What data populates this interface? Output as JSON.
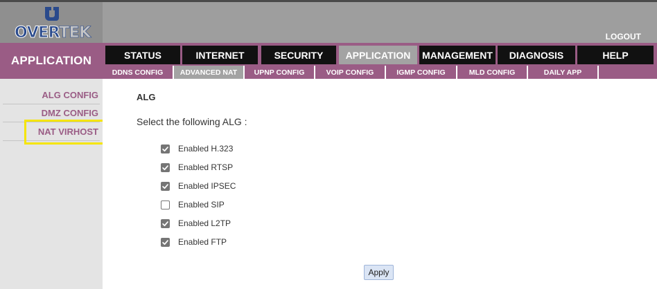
{
  "brand": {
    "logo_text": "OVERTEK"
  },
  "header": {
    "logout_label": "LOGOUT"
  },
  "section_title": "APPLICATION",
  "main_nav": [
    {
      "label": "STATUS",
      "active": false
    },
    {
      "label": "INTERNET",
      "active": false
    },
    {
      "label": "SECURITY",
      "active": false
    },
    {
      "label": "APPLICATION",
      "active": true
    },
    {
      "label": "MANAGEMENT",
      "active": false
    },
    {
      "label": "DIAGNOSIS",
      "active": false
    },
    {
      "label": "HELP",
      "active": false
    }
  ],
  "sub_nav": [
    {
      "label": "DDNS CONFIG",
      "active": false
    },
    {
      "label": "ADVANCED NAT",
      "active": true
    },
    {
      "label": "UPNP CONFIG",
      "active": false
    },
    {
      "label": "VOIP CONFIG",
      "active": false
    },
    {
      "label": "IGMP CONFIG",
      "active": false
    },
    {
      "label": "MLD CONFIG",
      "active": false
    },
    {
      "label": "DAILY APP",
      "active": false
    }
  ],
  "sidebar": [
    {
      "label": "ALG CONFIG",
      "highlighted": false
    },
    {
      "label": "DMZ CONFIG",
      "highlighted": false
    },
    {
      "label": "NAT VIRHOST",
      "highlighted": true
    }
  ],
  "main": {
    "title": "ALG",
    "instruction": "Select the following ALG :",
    "algs": [
      {
        "label": "Enabled H.323",
        "checked": true
      },
      {
        "label": "Enabled RTSP",
        "checked": true
      },
      {
        "label": "Enabled IPSEC",
        "checked": true
      },
      {
        "label": "Enabled SIP",
        "checked": false
      },
      {
        "label": "Enabled L2TP",
        "checked": true
      },
      {
        "label": "Enabled FTP",
        "checked": true
      }
    ],
    "apply_label": "Apply"
  },
  "colors": {
    "accent": "#9a5c85",
    "header_gray": "#9e9e9e",
    "nav_dark": "#111111",
    "active_tab": "#a3a3a3",
    "sidebar_bg": "#e4e4e4",
    "highlight": "#f5e500",
    "logo_blue": "#2a4a8c"
  }
}
